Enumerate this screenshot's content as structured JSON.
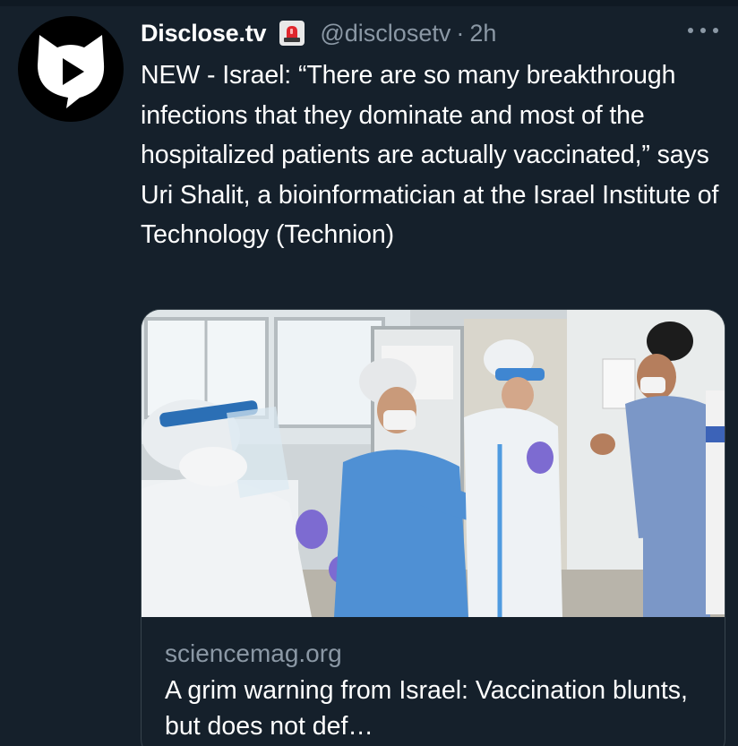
{
  "tweet": {
    "author": {
      "display_name": "Disclose.tv",
      "badge_icon": "emergency-siren-icon",
      "handle": "@disclosetv",
      "separator": "·",
      "time": "2h",
      "avatar_icon": "play-cat-logo-icon"
    },
    "more_icon": "more-options-icon",
    "text": "NEW - Israel: “There are so many breakthrough infections that they dominate and most of the hospitalized patients are actually vaccinated,” says Uri Shalit, a bioinformatician at the Israel Institute of Technology (Technion)",
    "card": {
      "image_description_icon": "hospital-staff-photo",
      "domain": "sciencemag.org",
      "title": "A grim warning from Israel: Vaccination blunts, but does not def…"
    }
  },
  "colors": {
    "background": "#15202b",
    "secondary_text": "#8b98a5",
    "border": "#38444d",
    "primary_text": "#ffffff"
  }
}
